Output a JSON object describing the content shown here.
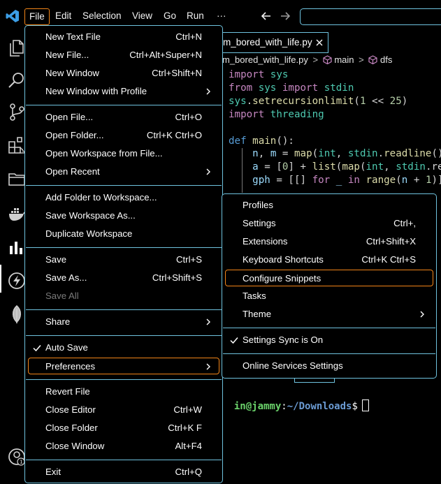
{
  "topmenu": [
    "File",
    "Edit",
    "Selection",
    "View",
    "Go",
    "Run",
    "···"
  ],
  "editor": {
    "tab_title": "m_bored_with_life.py",
    "breadcrumb": {
      "file": "m_bored_with_life.py",
      "sep": ">",
      "symbol1": "main",
      "symbol2": "dfs"
    },
    "code": [
      "import sys",
      "from sys import stdin",
      "sys.setrecursionlimit(1 << 25)",
      "import threading",
      "",
      "def main():",
      "    n, m = map(int, stdin.readline()",
      "    a = [0] + list(map(int, stdin.re",
      "    gph = [[] for _ in range(n + 1)]"
    ],
    "terminal": {
      "user": "in@jammy",
      "path": "~/Downloads",
      "prompt": "$"
    }
  },
  "file_menu": {
    "groups": [
      [
        {
          "label": "New Text File",
          "key": "Ctrl+N"
        },
        {
          "label": "New File...",
          "key": "Ctrl+Alt+Super+N"
        },
        {
          "label": "New Window",
          "key": "Ctrl+Shift+N"
        },
        {
          "label": "New Window with Profile",
          "key": "",
          "submenu": true
        }
      ],
      [
        {
          "label": "Open File...",
          "key": "Ctrl+O"
        },
        {
          "label": "Open Folder...",
          "key": "Ctrl+K Ctrl+O"
        },
        {
          "label": "Open Workspace from File...",
          "key": ""
        },
        {
          "label": "Open Recent",
          "key": "",
          "submenu": true
        }
      ],
      [
        {
          "label": "Add Folder to Workspace...",
          "key": ""
        },
        {
          "label": "Save Workspace As...",
          "key": ""
        },
        {
          "label": "Duplicate Workspace",
          "key": ""
        }
      ],
      [
        {
          "label": "Save",
          "key": "Ctrl+S"
        },
        {
          "label": "Save As...",
          "key": "Ctrl+Shift+S"
        },
        {
          "label": "Save All",
          "key": "",
          "disabled": true
        }
      ],
      [
        {
          "label": "Share",
          "key": "",
          "submenu": true
        }
      ],
      [
        {
          "label": "Auto Save",
          "key": "",
          "checked": true
        },
        {
          "label": "Preferences",
          "key": "",
          "submenu": true,
          "focused": true
        }
      ],
      [
        {
          "label": "Revert File",
          "key": ""
        },
        {
          "label": "Close Editor",
          "key": "Ctrl+W"
        },
        {
          "label": "Close Folder",
          "key": "Ctrl+K F"
        },
        {
          "label": "Close Window",
          "key": "Alt+F4"
        }
      ],
      [
        {
          "label": "Exit",
          "key": "Ctrl+Q"
        }
      ]
    ]
  },
  "preferences_menu": {
    "groups": [
      [
        {
          "label": "Profiles",
          "key": ""
        },
        {
          "label": "Settings",
          "key": "Ctrl+,"
        },
        {
          "label": "Extensions",
          "key": "Ctrl+Shift+X"
        },
        {
          "label": "Keyboard Shortcuts",
          "key": "Ctrl+K Ctrl+S"
        },
        {
          "label": "Configure Snippets",
          "key": "",
          "focused": true
        },
        {
          "label": "Tasks",
          "key": ""
        },
        {
          "label": "Theme",
          "key": "",
          "submenu": true
        }
      ],
      [
        {
          "label": "Settings Sync is On",
          "key": "",
          "checked": true
        }
      ],
      [
        {
          "label": "Online Services Settings",
          "key": ""
        }
      ]
    ]
  },
  "colors": {
    "focus_border": "#f38518",
    "contrast_border": "#6fc3df",
    "background": "#000000"
  }
}
